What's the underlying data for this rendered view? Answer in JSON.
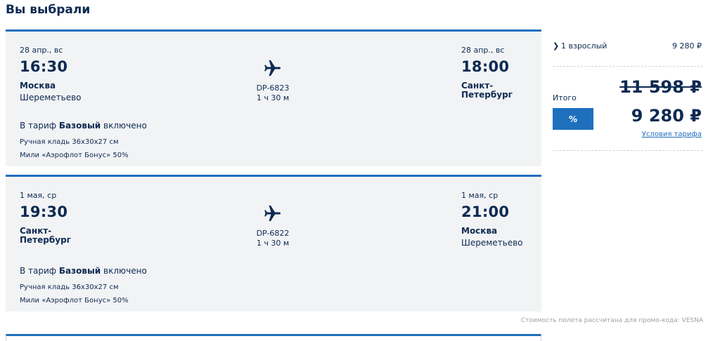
{
  "page": {
    "title": "Вы выбрали"
  },
  "flights": [
    {
      "dep_date": "28 апр., вс",
      "dep_time": "16:30",
      "dep_city": "Москва",
      "dep_airport": "Шереметьево",
      "flight_no": "DP-6823",
      "duration": "1 ч 30 м",
      "arr_date": "28 апр., вс",
      "arr_time": "18:00",
      "arr_city": "Санкт-Петербург",
      "arr_airport": "",
      "tariff_prefix": "В тариф ",
      "tariff_name": "Базовый",
      "tariff_suffix": " включено",
      "baggage": "Ручная кладь 36x30x27 см",
      "miles": "Мили «Аэрофлот Бонус» 50%"
    },
    {
      "dep_date": "1 мая, ср",
      "dep_time": "19:30",
      "dep_city": "Санкт-Петербург",
      "dep_airport": "",
      "flight_no": "DP-6822",
      "duration": "1 ч 30 м",
      "arr_date": "1 мая, ср",
      "arr_time": "21:00",
      "arr_city": "Москва",
      "arr_airport": "Шереметьево",
      "tariff_prefix": "В тариф ",
      "tariff_name": "Базовый",
      "tariff_suffix": " включено",
      "baggage": "Ручная кладь 36x30x27 см",
      "miles": "Мили «Аэрофлот Бонус» 50%"
    }
  ],
  "summary": {
    "passengers_label": "1 взрослый",
    "passengers_price": "9 280 ₽",
    "total_label": "Итого",
    "old_price": "11 598 ₽",
    "promo_badge": "%",
    "new_price": "9 280 ₽",
    "tariff_conditions": "Условия тарифа"
  },
  "promo_note": "Стоимость полета рассчитана для промо-кода: VESNA",
  "colors": {
    "accent": "#1f6fbf",
    "text": "#0d2a52",
    "card_bg": "#f2f3f5"
  },
  "icons": {
    "plane": "plane-icon",
    "chevron": "chevron-right-icon"
  }
}
